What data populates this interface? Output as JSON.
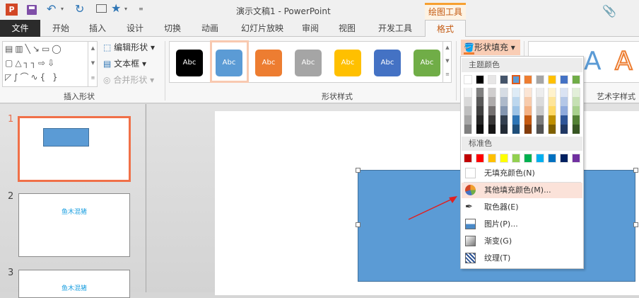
{
  "window": {
    "title": "演示文稿1 - PowerPoint",
    "context_tab_group": "绘图工具"
  },
  "tabs": [
    "文件",
    "开始",
    "插入",
    "设计",
    "切换",
    "动画",
    "幻灯片放映",
    "审阅",
    "视图",
    "开发工具",
    "格式"
  ],
  "ribbon": {
    "insert_shapes": {
      "label": "插入形状",
      "edit_shape": "编辑形状",
      "text_box": "文本框",
      "merge_shapes": "合并形状"
    },
    "shape_styles": {
      "label": "形状样式",
      "samples": [
        {
          "text": "Abc",
          "color": "#000000"
        },
        {
          "text": "Abc",
          "color": "#5b9bd5"
        },
        {
          "text": "Abc",
          "color": "#ed7d31"
        },
        {
          "text": "Abc",
          "color": "#a5a5a5"
        },
        {
          "text": "Abc",
          "color": "#ffc000"
        },
        {
          "text": "Abc",
          "color": "#4472c4"
        },
        {
          "text": "Abc",
          "color": "#70ad47"
        }
      ]
    },
    "shape_fill": "形状填充",
    "wordart": {
      "label": "艺术字样式",
      "letter": "A"
    }
  },
  "fill_menu": {
    "theme_heading": "主题颜色",
    "theme_colors": [
      "#ffffff",
      "#000000",
      "#e7e6e6",
      "#44546a",
      "#5b9bd5",
      "#ed7d31",
      "#a5a5a5",
      "#ffc000",
      "#4472c4",
      "#70ad47"
    ],
    "theme_shades": [
      [
        "#f2f2f2",
        "#d9d9d9",
        "#bfbfbf",
        "#a6a6a6",
        "#808080"
      ],
      [
        "#808080",
        "#595959",
        "#404040",
        "#262626",
        "#0d0d0d"
      ],
      [
        "#d0cece",
        "#aeabab",
        "#757171",
        "#3a3838",
        "#171616"
      ],
      [
        "#d6dce4",
        "#adb9ca",
        "#8496b0",
        "#333f4f",
        "#222a35"
      ],
      [
        "#deebf6",
        "#bdd7ee",
        "#9dc3e6",
        "#2e75b5",
        "#1f4e79"
      ],
      [
        "#fbe5d5",
        "#f7cbac",
        "#f4b183",
        "#c55a11",
        "#843c0b"
      ],
      [
        "#ededed",
        "#dbdbdb",
        "#c9c9c9",
        "#7b7b7b",
        "#525252"
      ],
      [
        "#fff2cc",
        "#fee599",
        "#ffd965",
        "#bf9000",
        "#7f6000"
      ],
      [
        "#dae3f3",
        "#b4c7e7",
        "#8faadc",
        "#2f5597",
        "#203864"
      ],
      [
        "#e2efd9",
        "#c5e0b3",
        "#a8d08d",
        "#538135",
        "#375623"
      ]
    ],
    "standard_heading": "标准色",
    "standard_colors": [
      "#c00000",
      "#ff0000",
      "#ffc000",
      "#ffff00",
      "#92d050",
      "#00b050",
      "#00b0f0",
      "#0070c0",
      "#002060",
      "#7030a0"
    ],
    "no_fill": "无填充颜色(N)",
    "more_colors": "其他填充颜色(M)...",
    "eyedropper": "取色器(E)",
    "picture": "图片(P)...",
    "gradient": "渐变(G)",
    "texture": "纹理(T)"
  },
  "slides": [
    {
      "number": "1"
    },
    {
      "number": "2",
      "text": "鱼木混猪"
    },
    {
      "number": "3",
      "text": "鱼木混猪"
    }
  ]
}
